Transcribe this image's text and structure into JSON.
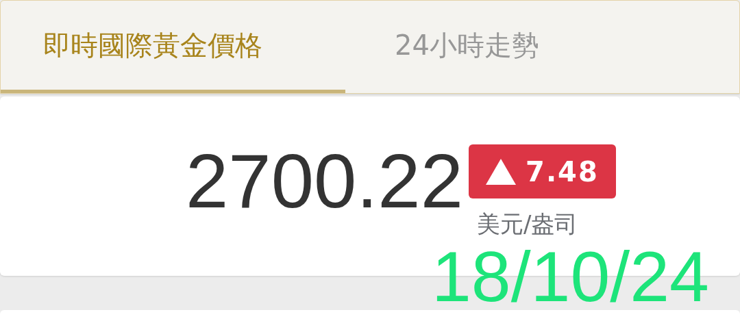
{
  "tabs": [
    {
      "label": "即時國際黃金價格",
      "selected": true
    },
    {
      "label": "24小時走勢",
      "selected": false
    }
  ],
  "price": {
    "value": "2700.22",
    "change": "7.48",
    "rising": true,
    "unit": "美元/盎司"
  },
  "date_stamp": "18/10/24"
}
